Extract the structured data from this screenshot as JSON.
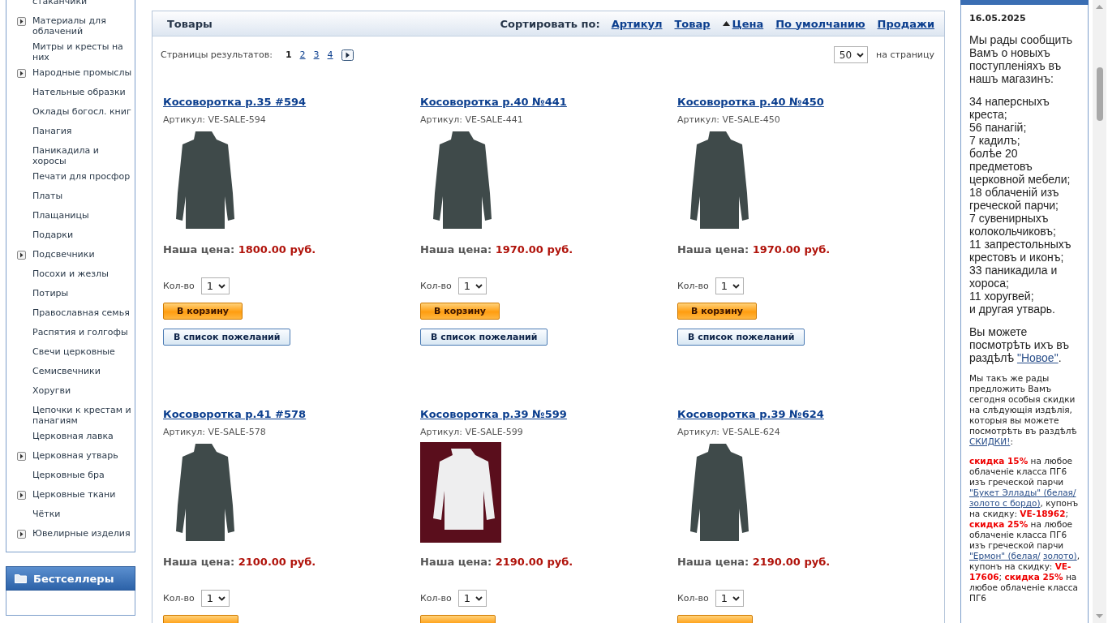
{
  "sidebar": {
    "categories": [
      {
        "label": "стаканчики",
        "expandable": false
      },
      {
        "label": "Материалы для облачений",
        "expandable": true
      },
      {
        "label": "Митры и кресты на них",
        "expandable": false
      },
      {
        "label": "Народные промыслы",
        "expandable": true
      },
      {
        "label": "Нательные образки",
        "expandable": false
      },
      {
        "label": "Оклады богосл. книг",
        "expandable": false
      },
      {
        "label": "Панагия",
        "expandable": false
      },
      {
        "label": "Паникадила и хоросы",
        "expandable": false
      },
      {
        "label": "Печати для просфор",
        "expandable": false
      },
      {
        "label": "Платы",
        "expandable": false
      },
      {
        "label": "Плащаницы",
        "expandable": false
      },
      {
        "label": "Подарки",
        "expandable": false
      },
      {
        "label": "Подсвечники",
        "expandable": true
      },
      {
        "label": "Посохи и жезлы",
        "expandable": false
      },
      {
        "label": "Потиры",
        "expandable": false
      },
      {
        "label": "Православная семья",
        "expandable": false
      },
      {
        "label": "Распятия и голгофы",
        "expandable": false
      },
      {
        "label": "Свечи церковные",
        "expandable": false
      },
      {
        "label": "Семисвечники",
        "expandable": false
      },
      {
        "label": "Хоругви",
        "expandable": false
      },
      {
        "label": "Цепочки к крестам и панагиям",
        "expandable": false
      },
      {
        "label": "Церковная лавка",
        "expandable": false
      },
      {
        "label": "Церковная утварь",
        "expandable": true
      },
      {
        "label": "Церковные бра",
        "expandable": false
      },
      {
        "label": "Церковные ткани",
        "expandable": true
      },
      {
        "label": "Чётки",
        "expandable": false
      },
      {
        "label": "Ювелирные изделия",
        "expandable": true
      }
    ],
    "bestsellers_title": "Бестселлеры"
  },
  "products_panel": {
    "title": "Товары",
    "sort_label": "Сортировать по:",
    "sort_options": [
      {
        "label": "Артикул",
        "selected": false
      },
      {
        "label": "Товар",
        "selected": false
      },
      {
        "label": "Цена",
        "selected": true
      },
      {
        "label": "По умолчанию",
        "selected": false
      },
      {
        "label": "Продажи",
        "selected": false
      }
    ],
    "pages_label": "Страницы результатов:",
    "pages": [
      {
        "label": "1",
        "selected": true
      },
      {
        "label": "2",
        "selected": false
      },
      {
        "label": "3",
        "selected": false
      },
      {
        "label": "4",
        "selected": false
      }
    ],
    "per_page_value": "50",
    "per_page_label": "на страницу",
    "products": [
      {
        "title": "Косоворотка р.35 #594",
        "sku": "Артикул: VE-SALE-594",
        "photo": {
          "kind": "cutout"
        },
        "price_label": "Наша цена:",
        "price": "1800.00 руб.",
        "qty_label": "Кол-во",
        "qty": "1",
        "cart_label": "В корзину",
        "wishlist_label": "В список пожеланий"
      },
      {
        "title": "Косоворотка р.40 №441",
        "sku": "Артикул: VE-SALE-441",
        "photo": {
          "kind": "cutout"
        },
        "price_label": "Наша цена:",
        "price": "1970.00 руб.",
        "qty_label": "Кол-во",
        "qty": "1",
        "cart_label": "В корзину",
        "wishlist_label": "В список пожеланий"
      },
      {
        "title": "Косоворотка р.40 №450",
        "sku": "Артикул: VE-SALE-450",
        "photo": {
          "kind": "cutout"
        },
        "price_label": "Наша цена:",
        "price": "1970.00 руб.",
        "qty_label": "Кол-во",
        "qty": "1",
        "cart_label": "В корзину",
        "wishlist_label": "В список пожеланий"
      },
      {
        "title": "Косоворотка р.41 #578",
        "sku": "Артикул: VE-SALE-578",
        "photo": {
          "kind": "cutout"
        },
        "price_label": "Наша цена:",
        "price": "2100.00 руб.",
        "qty_label": "Кол-во",
        "qty": "1",
        "cart_cut": true
      },
      {
        "title": "Косоворотка р.39 №599",
        "sku": "Артикул: VE-SALE-599",
        "photo": {
          "kind": "backdrop"
        },
        "price_label": "Наша цена:",
        "price": "2190.00 руб.",
        "qty_label": "Кол-во",
        "qty": "1",
        "cart_cut": true
      },
      {
        "title": "Косоворотка р.39 №624",
        "sku": "Артикул: VE-SALE-624",
        "photo": {
          "kind": "cutout"
        },
        "price_label": "Наша цена:",
        "price": "2190.00 руб.",
        "qty_label": "Кол-во",
        "qty": "1",
        "cart_cut": true
      }
    ]
  },
  "news": {
    "date": "16.05.2025",
    "intro": "Мы рады сообщить Вамъ о новыхъ поступленіяхъ въ нашъ магазинъ:",
    "list": [
      "34 наперсныхъ креста;",
      "56 панагій;",
      "7 кадилъ;",
      "болѣе 20 предметовъ церковной мебели;",
      "18 облаченій изъ греческой парчи;",
      "7 сувенирныхъ колокольчиковъ;",
      "11 запрестольныхъ крестовъ и иконъ;",
      "33 паникадила и хороса;",
      "11 хоругвей;",
      "и другая утварь."
    ],
    "more": [
      {
        "kind": "text",
        "text": "Вы можете посмотрѣть ихъ въ раздѣлѣ "
      },
      {
        "kind": "link",
        "text": "\"Новое\""
      },
      {
        "kind": "text",
        "text": "."
      }
    ],
    "promo": [
      {
        "kind": "text",
        "text": "Мы такъ же рады предложить Вамъ сегодня особыя скидки на слѣдующія издѣлія, которыя вы можете посмотрѣть въ раздѣлѣ "
      },
      {
        "kind": "link",
        "text": "СКИДКИ!"
      },
      {
        "kind": "text",
        "text": ":"
      }
    ],
    "offers": [
      {
        "kind": "strong",
        "text": "скидка 15%"
      },
      {
        "kind": "text",
        "text": " на любое облаченіе класса ПГ6 изъ греческой парчи "
      },
      {
        "kind": "link",
        "text": "\"Букет Эллады\" (белая/",
        "continued": true
      },
      {
        "kind": "link",
        "text": "золото с бордо)"
      },
      {
        "kind": "text",
        "text": ", купонъ на скидку: "
      },
      {
        "kind": "strong",
        "text": "VE-18962"
      },
      {
        "kind": "text",
        "text": "; "
      },
      {
        "kind": "strong",
        "text": "скидка 25%"
      },
      {
        "kind": "text",
        "text": " на любое облаченіе класса ПГ6 изъ греческой парчи "
      },
      {
        "kind": "link",
        "text": "\"Ермон\" (белая/",
        "continued": true
      },
      {
        "kind": "link",
        "text": "золото)"
      },
      {
        "kind": "text",
        "text": ", купонъ на скидку: "
      },
      {
        "kind": "strong",
        "text": "VE-17606"
      },
      {
        "kind": "text",
        "text": "; "
      },
      {
        "kind": "strong",
        "text": "скидка 25%"
      },
      {
        "kind": "text",
        "text": " на любое облаченіе класса ПГ6"
      }
    ]
  }
}
